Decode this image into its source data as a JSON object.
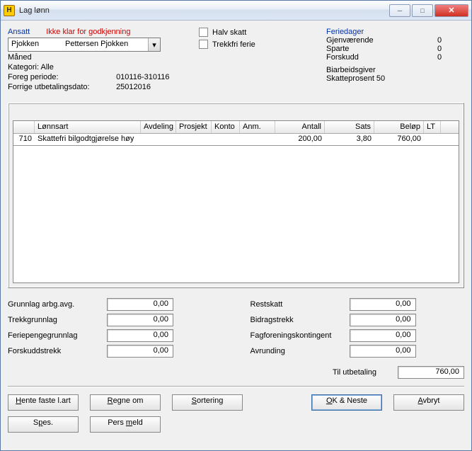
{
  "window": {
    "title": "Lag lønn",
    "icon": "H"
  },
  "labels": {
    "ansatt": "Ansatt",
    "warning": "Ikke klar for godkjenning",
    "maned": "Måned",
    "kategori": "Kategori: Alle",
    "foreg_periode": "Foreg periode:",
    "foreg_periode_val": "010116-310116",
    "forrige_utbet": "Forrige utbetalingsdato:",
    "forrige_utbet_val": "25012016",
    "halv_skatt": "Halv skatt",
    "trekkfri_ferie": "Trekkfri ferie",
    "feriedager": "Feriedager",
    "gjenvaerende": "Gjenværende",
    "sparte": "Sparte",
    "forskudd": "Forskudd",
    "biarbeidsgiver": "Biarbeidsgiver",
    "skatteprosent": "Skatteprosent 50",
    "til_utbetaling": "Til utbetaling"
  },
  "dropdown": {
    "col1": "Pjokken",
    "col2": "Pettersen Pjokken"
  },
  "ferie": {
    "gjenvaerende": "0",
    "sparte": "0",
    "forskudd": "0"
  },
  "grid": {
    "headers": {
      "code": "",
      "art": "Lønnsart",
      "avd": "Avdeling",
      "pro": "Prosjekt",
      "konto": "Konto",
      "anm": "Anm.",
      "antall": "Antall",
      "sats": "Sats",
      "belop": "Beløp",
      "lt": "LT"
    },
    "rows": [
      {
        "code": "710",
        "art": "Skattefri bilgodtgjørelse høy",
        "avd": "",
        "pro": "",
        "konto": "",
        "anm": "",
        "antall": "200,00",
        "sats": "3,80",
        "belop": "760,00",
        "lt": ""
      }
    ]
  },
  "totals_left": {
    "grunnlag_arbg": {
      "label": "Grunnlag arbg.avg.",
      "value": "0,00"
    },
    "trekkgrunnlag": {
      "label": "Trekkgrunnlag",
      "value": "0,00"
    },
    "feriepengegrunnlag": {
      "label": "Feriepengegrunnlag",
      "value": "0,00"
    },
    "forskuddstrekk": {
      "label": "Forskuddstrekk",
      "value": "0,00"
    }
  },
  "totals_right": {
    "restskatt": {
      "label": "Restskatt",
      "value": "0,00"
    },
    "bidragstrekk": {
      "label": "Bidragstrekk",
      "value": "0,00"
    },
    "fagforening": {
      "label": "Fagforeningskontingent",
      "value": "0,00"
    },
    "avrunding": {
      "label": "Avrunding",
      "value": "0,00"
    }
  },
  "payout": "760,00",
  "buttons": {
    "hente": "Hente faste l.art",
    "regne": "Regne om",
    "sortering": "Sortering",
    "ok_neste": "OK & Neste",
    "avbryt": "Avbryt",
    "spes": "Spes.",
    "pers_meld": "Pers meld"
  }
}
